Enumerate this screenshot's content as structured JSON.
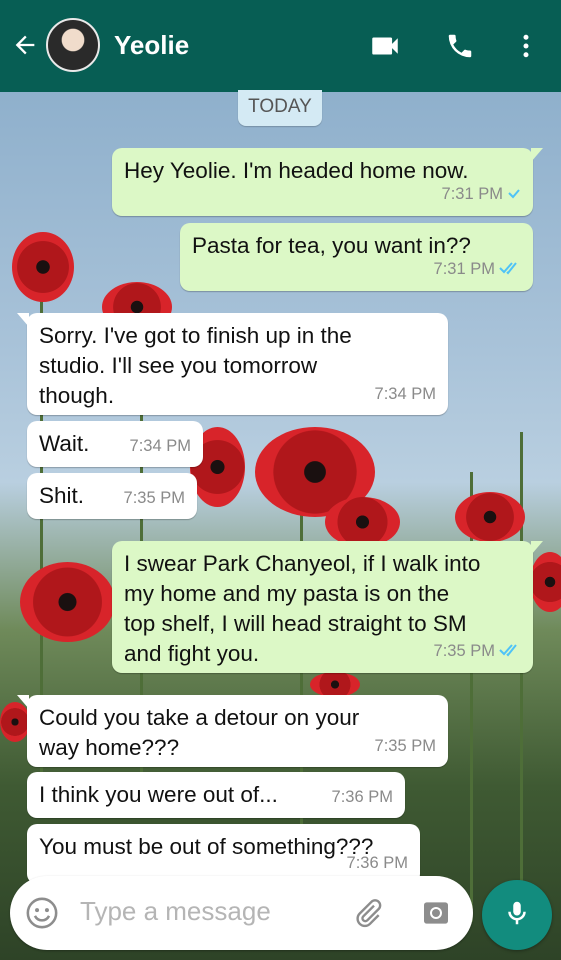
{
  "header": {
    "contact_name": "Yeolie",
    "icons": [
      "back-arrow-icon",
      "video-call-icon",
      "voice-call-icon",
      "more-options-icon"
    ],
    "color": "#075e54"
  },
  "date_divider": "TODAY",
  "messages": [
    {
      "dir": "out",
      "lines": [
        "Hey Yeolie. I'm headed home now."
      ],
      "time": "7:31 PM",
      "status": "sent"
    },
    {
      "dir": "out",
      "lines": [
        "Pasta for tea, you want in??"
      ],
      "time": "7:31 PM",
      "status": "read"
    },
    {
      "dir": "in",
      "lines": [
        "Sorry. I've got to finish up in the",
        "studio. I'll see you tomorrow",
        "though."
      ],
      "time": "7:34 PM"
    },
    {
      "dir": "in",
      "lines": [
        "Wait."
      ],
      "time": "7:34 PM"
    },
    {
      "dir": "in",
      "lines": [
        "Shit."
      ],
      "time": "7:35 PM"
    },
    {
      "dir": "out",
      "lines": [
        "I swear Park Chanyeol, if I walk into",
        "my home and my pasta is on the",
        "top shelf, I will head straight to SM",
        "and fight you."
      ],
      "time": "7:35 PM",
      "status": "read"
    },
    {
      "dir": "in",
      "lines": [
        "Could you take a detour on your",
        "way home???"
      ],
      "time": "7:35 PM"
    },
    {
      "dir": "in",
      "lines": [
        "I think you were out of..."
      ],
      "time": "7:36 PM"
    },
    {
      "dir": "in",
      "lines": [
        "You must be out of something???"
      ],
      "time": "7:36 PM"
    }
  ],
  "composer": {
    "placeholder": "Type a message",
    "icons": [
      "emoji-icon",
      "attach-icon",
      "camera-icon",
      "mic-icon"
    ]
  },
  "colors": {
    "outgoing_bubble": "#dcf8c6",
    "incoming_bubble": "#ffffff",
    "read_ticks": "#4fc3f7",
    "fab": "#128c7e"
  }
}
